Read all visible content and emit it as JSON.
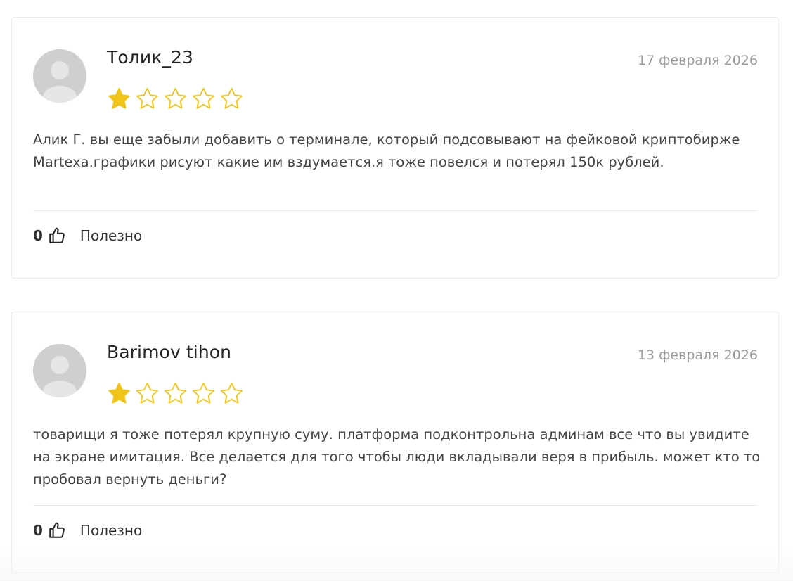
{
  "reviews": [
    {
      "author": "Толик_23",
      "date": "17 февраля 2026",
      "rating": 1,
      "max_rating": 5,
      "text": "Алик Г. вы еще забыли добавить о терминале, который подсовывают на фейковой криптобирже Martexa.графики рисуют какие им вздумается.я тоже повелся и потерял 150к рублей.",
      "helpful_count": "0",
      "helpful_label": "Полезно"
    },
    {
      "author": "Barimov tihon",
      "date": "13 февраля 2026",
      "rating": 1,
      "max_rating": 5,
      "text": "товарищи я тоже потерял крупную суму. платформа подконтрольна админам все что вы увидите на экране имитация. Все делается для того чтобы люди вкладывали веря в прибыль. может кто то пробовал вернуть деньги?",
      "helpful_count": "0",
      "helpful_label": "Полезно"
    }
  ],
  "colors": {
    "star_fill": "#f0c419",
    "star_outline": "#f0c419",
    "avatar_bg": "#cfcfcf",
    "text": "#444444",
    "date": "#9a9a9a"
  },
  "icons": {
    "avatar": "user-silhouette-icon",
    "star_filled": "star-filled-icon",
    "star_empty": "star-outline-icon",
    "like": "thumbs-up-icon"
  }
}
